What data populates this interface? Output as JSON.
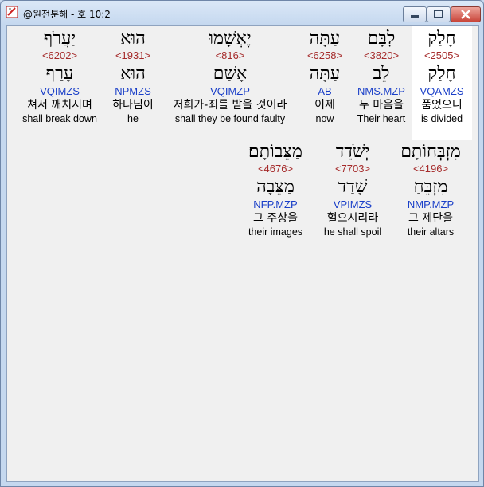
{
  "window": {
    "title": "@원전분해 - 호 10:2",
    "icon": "app-icon"
  },
  "row1": [
    {
      "hebrew": "יַעֲרֹף",
      "strong": "<6202>",
      "lemma": "עָרַף",
      "morph": "VQIMZS",
      "korean": "쳐서 깨치시며",
      "english": "shall break down"
    },
    {
      "hebrew": "הוּא",
      "strong": "<1931>",
      "lemma": "הוּא",
      "morph": "NPMZS",
      "korean": "하나님이",
      "english": "he"
    },
    {
      "hebrew": "יֶאְשָׁמוּ",
      "strong": "<816>",
      "lemma": "אָשַׁם",
      "morph": "VQIMZP",
      "korean": "저희가-죄를 받을 것이라",
      "english": "shall they be found faulty"
    },
    {
      "hebrew": "עַתָּה",
      "strong": "<6258>",
      "lemma": "עַתָּה",
      "morph": "AB",
      "korean": "이제",
      "english": "now"
    },
    {
      "hebrew": "לִבָּם",
      "strong": "<3820>",
      "lemma": "לֵב",
      "morph": "NMS.MZP",
      "korean": "두 마음을",
      "english": "Their heart"
    },
    {
      "hebrew": "חָלַק",
      "strong": "<2505>",
      "lemma": "חָלַק",
      "morph": "VQAMZS",
      "korean": "품었으니",
      "english": "is divided"
    }
  ],
  "row2": [
    {
      "hebrew": "מַצֵּבוֹתָם׃",
      "strong": "<4676>",
      "lemma": "מַצֵּבָה",
      "morph": "NFP.MZP",
      "korean": "그 주상을",
      "english": "their images"
    },
    {
      "hebrew": "יְשֹׁדֵד",
      "strong": "<7703>",
      "lemma": "שָׁדַד",
      "morph": "VPIMZS",
      "korean": "헐으시리라",
      "english": "he shall spoil"
    },
    {
      "hebrew": "מִזְבְּחוֹתָם",
      "strong": "<4196>",
      "lemma": "מִזְבֵּחַ",
      "morph": "NMP.MZP",
      "korean": "그 제단을",
      "english": "their altars"
    }
  ],
  "colors": {
    "strong": "#a52a2a",
    "morph": "#1a3fc8",
    "client_bg": "#f0f0f0",
    "selected_bg": "#ffffff"
  }
}
